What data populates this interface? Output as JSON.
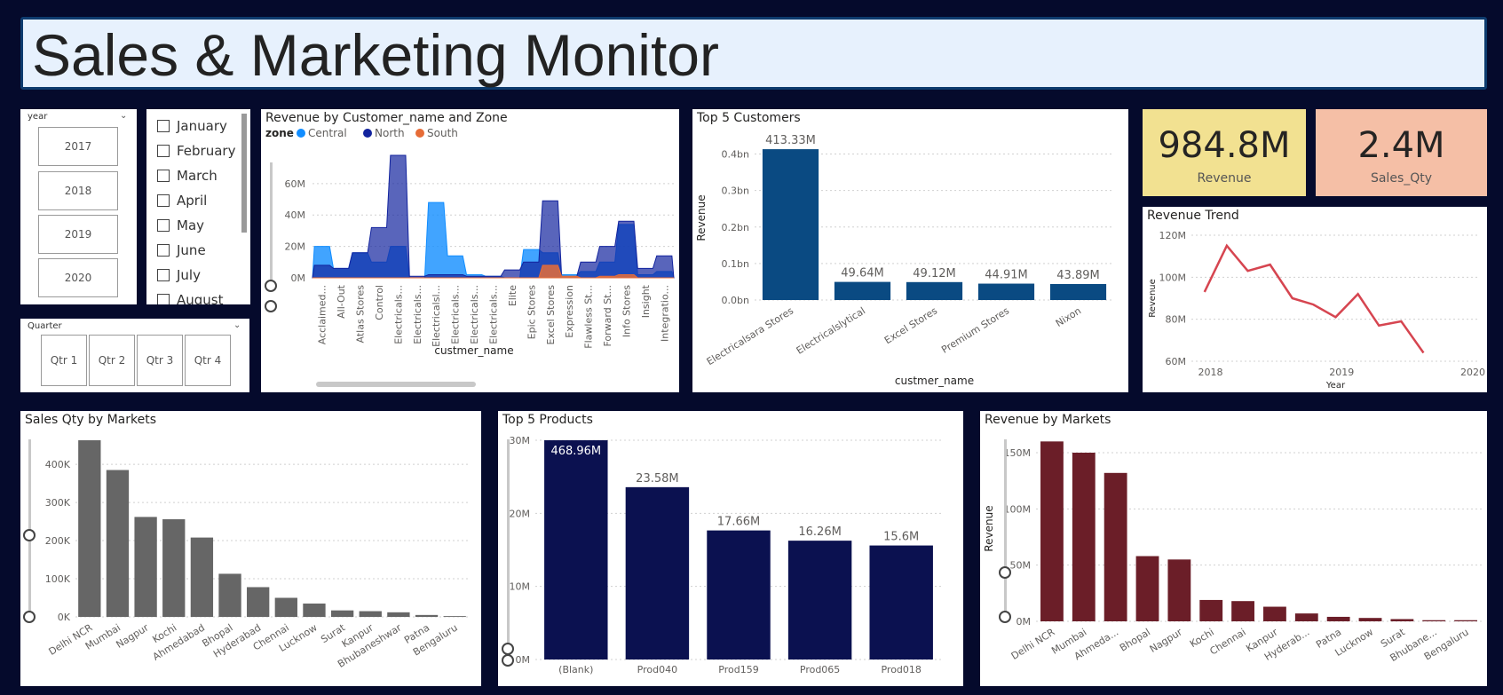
{
  "header": {
    "title": "Sales & Marketing Monitor"
  },
  "year_slicer": {
    "header": "year",
    "items": [
      "2017",
      "2018",
      "2019",
      "2020"
    ]
  },
  "month_slicer": {
    "items": [
      "January",
      "February",
      "March",
      "April",
      "May",
      "June",
      "July",
      "August"
    ]
  },
  "quarter_slicer": {
    "header": "Quarter",
    "items": [
      "Qtr 1",
      "Qtr 2",
      "Qtr 3",
      "Qtr 4"
    ]
  },
  "kpis": {
    "revenue": {
      "value": "984.8M",
      "label": "Revenue",
      "color": "#f2e191"
    },
    "sales_qty": {
      "value": "2.4M",
      "label": "Sales_Qty",
      "color": "#f5bfa6"
    }
  },
  "chart_data": [
    {
      "id": "rev-customer-zone",
      "type": "area",
      "title": "Revenue by Customer_name and Zone",
      "xlabel": "custmer_name",
      "legend_title": "zone",
      "legend_placement": "top-left",
      "ylim": [
        0,
        78
      ],
      "yticks": [
        "0M",
        "20M",
        "40M",
        "60M"
      ],
      "categories": [
        "Acclaimed...",
        "All-Out",
        "Atlas Stores",
        "Control",
        "Electricals...",
        "Electricals...",
        "Electricalsl...",
        "Electricals...",
        "Electricals...",
        "Electricals...",
        "Elite",
        "Epic Stores",
        "Excel Stores",
        "Expression",
        "Flawless St...",
        "Forward St...",
        "Info Stores",
        "Insight",
        "Integratio..."
      ],
      "series": [
        {
          "name": "Central",
          "color": "#118dff",
          "values": [
            20,
            6,
            16,
            10,
            20,
            0,
            48,
            14,
            2,
            1,
            0,
            18,
            16,
            2,
            4,
            10,
            34,
            2,
            4
          ]
        },
        {
          "name": "North",
          "color": "#12239e",
          "values": [
            8,
            6,
            16,
            32,
            78,
            1,
            2,
            2,
            1,
            1,
            5,
            10,
            49,
            1,
            10,
            20,
            36,
            6,
            14
          ]
        },
        {
          "name": "South",
          "color": "#e66c37",
          "values": [
            0,
            0,
            0,
            0,
            0,
            0,
            0,
            0,
            0,
            0,
            0,
            0,
            8,
            1,
            0,
            1,
            2,
            0,
            0
          ]
        }
      ]
    },
    {
      "id": "top5-customers",
      "type": "bar",
      "title": "Top 5 Customers",
      "xlabel": "custmer_name",
      "ylabel": "Revenue",
      "ylim": [
        0,
        0.45
      ],
      "yticks": [
        "0.0bn",
        "0.1bn",
        "0.2bn",
        "0.3bn",
        "0.4bn"
      ],
      "categories": [
        "Electricalsara Stores",
        "Electricalslytical",
        "Excel Stores",
        "Premium Stores",
        "Nixon"
      ],
      "values": [
        0.41333,
        0.04964,
        0.04912,
        0.04491,
        0.04389
      ],
      "labels": [
        "413.33M",
        "49.64M",
        "49.12M",
        "44.91M",
        "43.89M"
      ],
      "color": "#0a4a82"
    },
    {
      "id": "revenue-trend",
      "type": "line",
      "title": "Revenue Trend",
      "xlabel": "Year",
      "ylabel": "Revenue",
      "ylim": [
        60,
        120
      ],
      "yticks": [
        "60M",
        "80M",
        "100M",
        "120M"
      ],
      "xticks": [
        "2018",
        "2019",
        "2020"
      ],
      "x": [
        2017.75,
        2017.92,
        2018.08,
        2018.25,
        2018.42,
        2018.58,
        2018.75,
        2018.92,
        2019.08,
        2019.25,
        2019.42,
        2019.58,
        2019.75
      ],
      "values": [
        93,
        115,
        103,
        106,
        90,
        87,
        81,
        92,
        77,
        79,
        64,
        0,
        0
      ],
      "color": "#d64550"
    },
    {
      "id": "sales-qty-markets",
      "type": "bar",
      "title": "Sales Qty by Markets",
      "ylim": [
        0,
        470
      ],
      "yticks": [
        "0K",
        "100K",
        "200K",
        "300K",
        "400K"
      ],
      "categories": [
        "Delhi NCR",
        "Mumbai",
        "Nagpur",
        "Kochi",
        "Ahmedabad",
        "Bhopal",
        "Hyderabad",
        "Chennai",
        "Lucknow",
        "Surat",
        "Kanpur",
        "Bhubaneshwar",
        "Patna",
        "Bengaluru"
      ],
      "values": [
        463,
        385,
        262,
        256,
        208,
        113,
        78,
        50,
        35,
        17,
        15,
        12,
        5,
        2
      ],
      "color": "#666666"
    },
    {
      "id": "top5-products",
      "type": "bar",
      "title": "Top 5 Products",
      "ylim": [
        0,
        30
      ],
      "yticks": [
        "0M",
        "10M",
        "20M",
        "30M"
      ],
      "categories": [
        "(Blank)",
        "Prod040",
        "Prod159",
        "Prod065",
        "Prod018"
      ],
      "values": [
        468.96,
        23.58,
        17.66,
        16.26,
        15.6
      ],
      "labels": [
        "468.96M",
        "23.58M",
        "17.66M",
        "16.26M",
        "15.6M"
      ],
      "color": "#0b1150"
    },
    {
      "id": "revenue-markets",
      "type": "bar",
      "title": "Revenue by Markets",
      "ylabel": "Revenue",
      "ylim": [
        0,
        165
      ],
      "yticks": [
        "0M",
        "50M",
        "100M",
        "150M"
      ],
      "categories": [
        "Delhi NCR",
        "Mumbai",
        "Ahmeda...",
        "Bhopal",
        "Nagpur",
        "Kochi",
        "Chennai",
        "Kanpur",
        "Hyderab...",
        "Patna",
        "Lucknow",
        "Surat",
        "Bhubane...",
        "Bengaluru"
      ],
      "values": [
        160,
        150,
        132,
        58,
        55,
        19,
        18,
        13,
        7,
        4,
        3,
        2,
        1,
        1
      ],
      "color": "#6b1e28"
    }
  ]
}
